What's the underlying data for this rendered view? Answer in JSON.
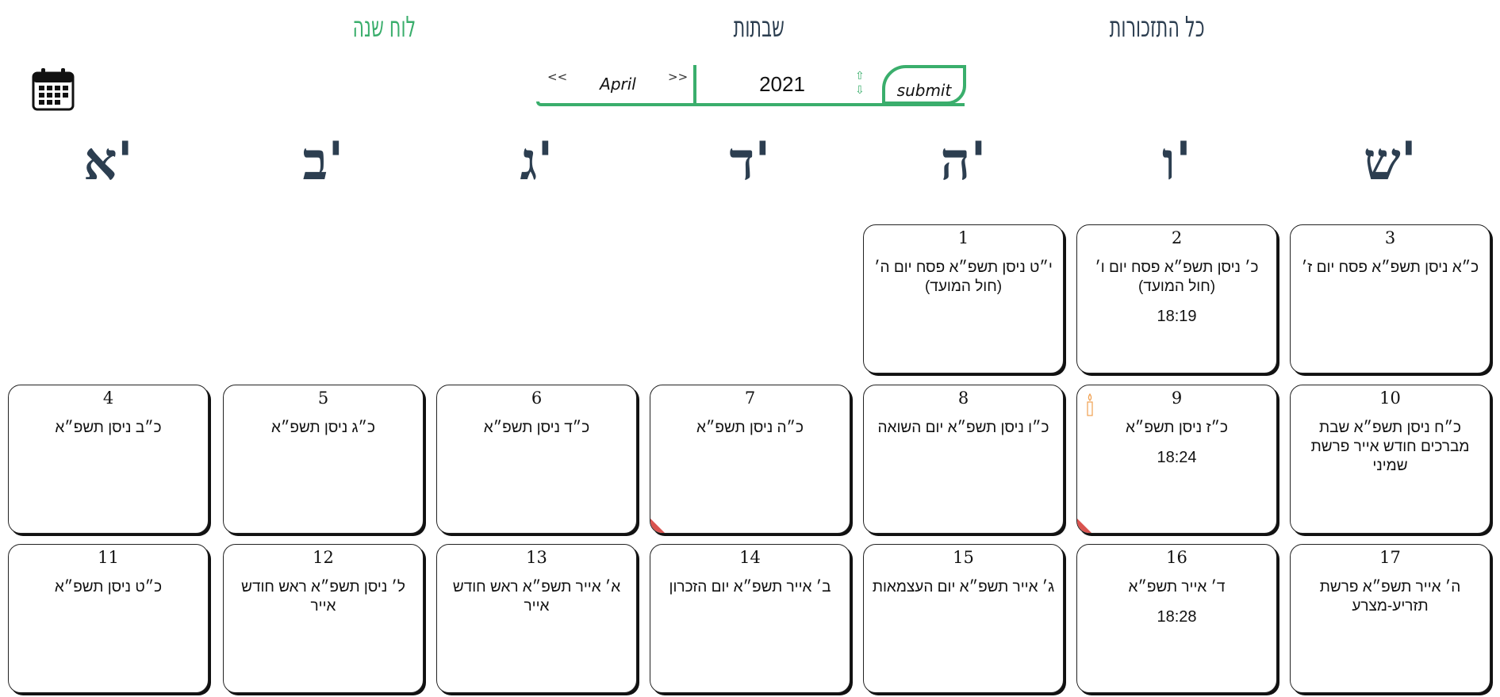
{
  "nav": {
    "calendar_year": "לוח שנה",
    "shabbatot": "שבתות",
    "all_reminders": "כל התזכורות"
  },
  "controls": {
    "prev": "<<",
    "next": ">>",
    "month": "April",
    "year": "2021",
    "year_up": "⇧",
    "year_down": "⇩",
    "submit": "submit"
  },
  "weekdays": [
    "ש'",
    "ו'",
    "ה'",
    "ד'",
    "ג'",
    "ב'",
    "א'"
  ],
  "weeks": [
    [
      {
        "num": "3",
        "text": "כ״א ניסן תשפ״א פסח יום ז׳",
        "time": "",
        "mark": false,
        "candle": false
      },
      {
        "num": "2",
        "text": "כ׳ ניסן תשפ״א פסח יום ו׳ (חול המועד)",
        "time": "18:19",
        "mark": false,
        "candle": false
      },
      {
        "num": "1",
        "text": "י״ט ניסן תשפ״א פסח יום ה׳ (חול המועד)",
        "time": "",
        "mark": false,
        "candle": false
      }
    ],
    [
      {
        "num": "10",
        "text": "כ״ח ניסן תשפ״א שבת מברכים חודש אייר פרשת שמיני",
        "time": "",
        "mark": false,
        "candle": false
      },
      {
        "num": "9",
        "text": "כ״ז ניסן תשפ״א",
        "time": "18:24",
        "mark": true,
        "candle": true
      },
      {
        "num": "8",
        "text": "כ״ו ניסן תשפ״א יום השואה",
        "time": "",
        "mark": false,
        "candle": false
      },
      {
        "num": "7",
        "text": "כ״ה ניסן תשפ״א",
        "time": "",
        "mark": true,
        "candle": false
      },
      {
        "num": "6",
        "text": "כ״ד ניסן תשפ״א",
        "time": "",
        "mark": false,
        "candle": false
      },
      {
        "num": "5",
        "text": "כ״ג ניסן תשפ״א",
        "time": "",
        "mark": false,
        "candle": false
      },
      {
        "num": "4",
        "text": "כ״ב ניסן תשפ״א",
        "time": "",
        "mark": false,
        "candle": false
      }
    ],
    [
      {
        "num": "17",
        "text": "ה׳ אייר תשפ״א פרשת תזריע-מצרע",
        "time": "",
        "mark": false,
        "candle": false
      },
      {
        "num": "16",
        "text": "ד׳ אייר תשפ״א",
        "time": "18:28",
        "mark": false,
        "candle": false
      },
      {
        "num": "15",
        "text": "ג׳ אייר תשפ״א יום העצמאות",
        "time": "",
        "mark": false,
        "candle": false
      },
      {
        "num": "14",
        "text": "ב׳ אייר תשפ״א יום הזכרון",
        "time": "",
        "mark": false,
        "candle": false
      },
      {
        "num": "13",
        "text": "א׳ אייר תשפ״א ראש חודש אייר",
        "time": "",
        "mark": false,
        "candle": false
      },
      {
        "num": "12",
        "text": "ל׳ ניסן תשפ״א ראש חודש אייר",
        "time": "",
        "mark": false,
        "candle": false
      },
      {
        "num": "11",
        "text": "כ״ט ניסן תשפ״א",
        "time": "",
        "mark": false,
        "candle": false
      }
    ]
  ],
  "colors": {
    "accent": "#3aae6c",
    "heading": "#2c3e50",
    "mark": "#d9534f"
  }
}
